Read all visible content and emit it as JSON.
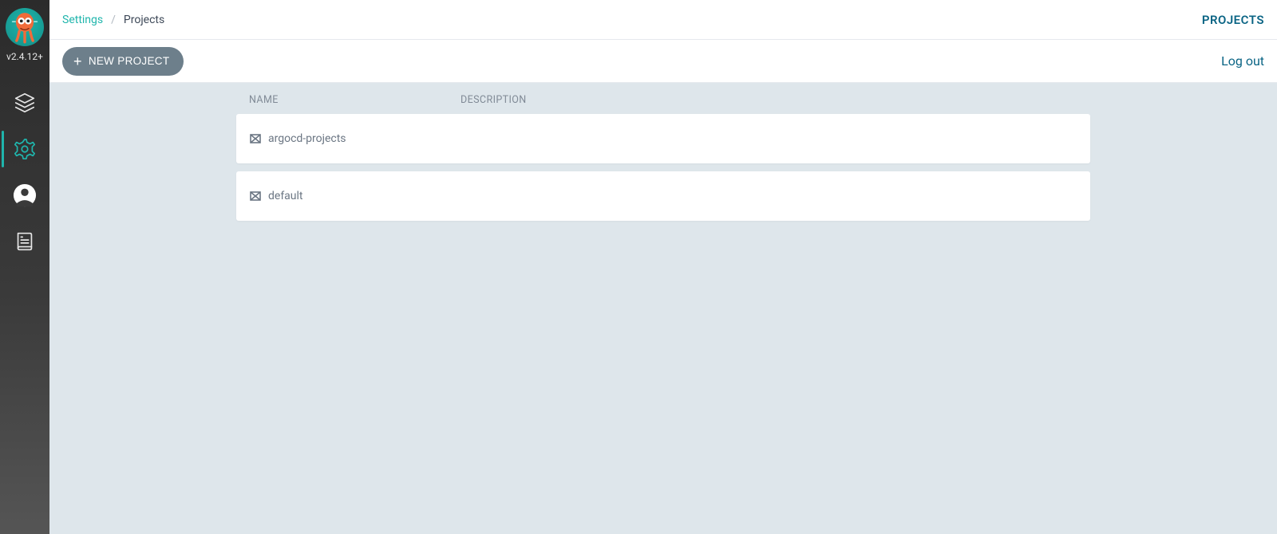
{
  "sidebar": {
    "version": "v2.4.12+"
  },
  "header": {
    "breadcrumb_root": "Settings",
    "breadcrumb_current": "Projects",
    "projects_label": "PROJECTS"
  },
  "toolbar": {
    "new_project_label": "NEW PROJECT",
    "logout_label": "Log out"
  },
  "table": {
    "columns": {
      "name": "NAME",
      "description": "DESCRIPTION"
    },
    "rows": [
      {
        "name": "argocd-projects",
        "description": ""
      },
      {
        "name": "default",
        "description": ""
      }
    ]
  }
}
